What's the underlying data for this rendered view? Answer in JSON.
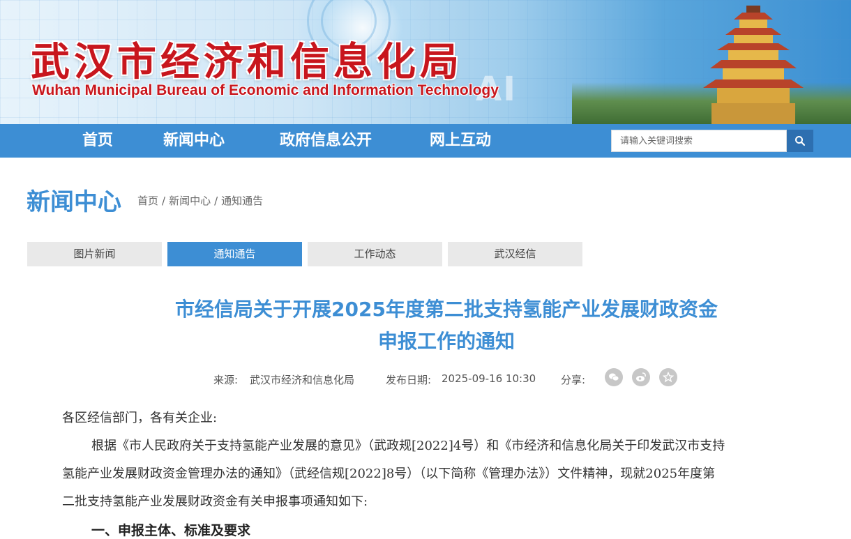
{
  "header": {
    "title_cn": "武汉市经济和信息化局",
    "title_en": "Wuhan Municipal Bureau of Economic and Information Technology",
    "decor_text": "AI",
    "brand_red": "#c8161d"
  },
  "nav": {
    "items": [
      {
        "label": "首页"
      },
      {
        "label": "新闻中心"
      },
      {
        "label": "政府信息公开"
      },
      {
        "label": "网上互动"
      }
    ],
    "search_placeholder": "请输入关键词搜索",
    "search_icon": "search-icon",
    "color": "#3d8ed4"
  },
  "section": {
    "title": "新闻中心",
    "breadcrumb": [
      {
        "label": "首页"
      },
      {
        "label": "新闻中心"
      },
      {
        "label": "通知通告"
      }
    ],
    "separator": "/"
  },
  "tabs": [
    {
      "label": "图片新闻",
      "active": false
    },
    {
      "label": "通知通告",
      "active": true
    },
    {
      "label": "工作动态",
      "active": false
    },
    {
      "label": "武汉经信",
      "active": false
    }
  ],
  "article": {
    "title_line1": "市经信局关于开展2025年度第二批支持氢能产业发展财政资金",
    "title_line2": "申报工作的通知",
    "source_label": "来源:",
    "source": "武汉市经济和信息化局",
    "date_label": "发布日期:",
    "date": "2025-09-16 10:30",
    "share_label": "分享:",
    "share_icons": [
      "wechat-icon",
      "weibo-icon",
      "star-icon"
    ],
    "salutation": "各区经信部门，各有关企业:",
    "para_line1": "根据《市人民政府关于支持氢能产业发展的意见》（武政规[2022]4号）和《市经济和信息化局关于印发武汉市支持",
    "para_line2": "氢能产业发展财政资金管理办法的通知》（武经信规[2022]8号）（以下简称《管理办法》）文件精神，现就2025年度第",
    "para_line3": "二批支持氢能产业发展财政资金有关申报事项通知如下:",
    "heading1": "一、申报主体、标准及要求"
  }
}
